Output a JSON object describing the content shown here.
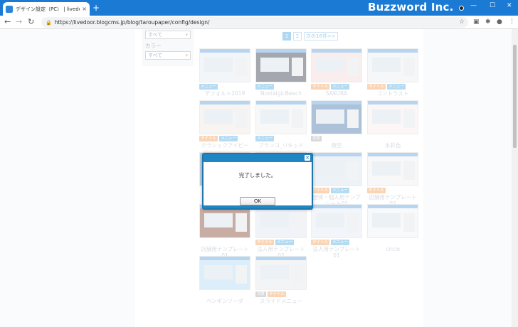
{
  "browser": {
    "tab_title": "デザイン設定（PC） | livedoor Blo",
    "tab_close": "×",
    "new_tab": "+",
    "brand_watermark": "Buzzword Inc.",
    "url": "https://livedoor.blogcms.jp/blog/taroupaper/config/design/",
    "window_controls": [
      "—",
      "☐",
      "✕"
    ]
  },
  "sidebar": {
    "select1_value": "すべて",
    "color_label": "カラー",
    "select2_value": "すべて"
  },
  "pager": {
    "pages": [
      "1",
      "2"
    ],
    "next": "次の16件>>"
  },
  "templates": [
    {
      "name": "デフォルト2019",
      "tags": [
        "メニュー"
      ]
    },
    {
      "name": "NostalgicBeach",
      "tags": [
        "メニュー"
      ]
    },
    {
      "name": "SAKURA",
      "tags": [
        "タイトル",
        "メニュー"
      ]
    },
    {
      "name": "コントラスト",
      "tags": [
        "タイトル",
        "メニュー"
      ]
    },
    {
      "name": "クラシックアイビー",
      "tags": [
        "タイトル",
        "メニュー"
      ]
    },
    {
      "name": "ブランコ_リキッド",
      "tags": [
        "メニュー"
      ]
    },
    {
      "name": "夜空",
      "tags": [
        "背景"
      ]
    },
    {
      "name": "水彩色",
      "tags": []
    },
    {
      "name": "ギャラリー",
      "tags": []
    },
    {
      "name": "タイムライン",
      "tags": []
    },
    {
      "name": "団体・個人用テンプレート01",
      "tags": [
        "タイトル",
        "メニュー"
      ]
    },
    {
      "name": "店舗用テンプレート02",
      "tags": [
        "タイトル"
      ]
    },
    {
      "name": "店舗用テンプレート01",
      "tags": []
    },
    {
      "name": "法人用テンプレート02",
      "tags": [
        "タイトル",
        "メニュー"
      ]
    },
    {
      "name": "法人用テンプレート01",
      "tags": [
        "タイトル",
        "メニュー"
      ]
    },
    {
      "name": "circle",
      "tags": []
    },
    {
      "name": "ペンギンソーダ",
      "tags": []
    },
    {
      "name": "スライドメニュー",
      "tags": [
        "背景",
        "タイトル"
      ]
    }
  ],
  "dialog": {
    "close": "✕",
    "message": "完了しました。",
    "ok_label": "OK"
  },
  "colors": {
    "titlebar": "#1b7ad3",
    "dialog_border": "#1f76ad",
    "tag_title": "#f5b27a",
    "tag_menu": "#79bde8"
  }
}
